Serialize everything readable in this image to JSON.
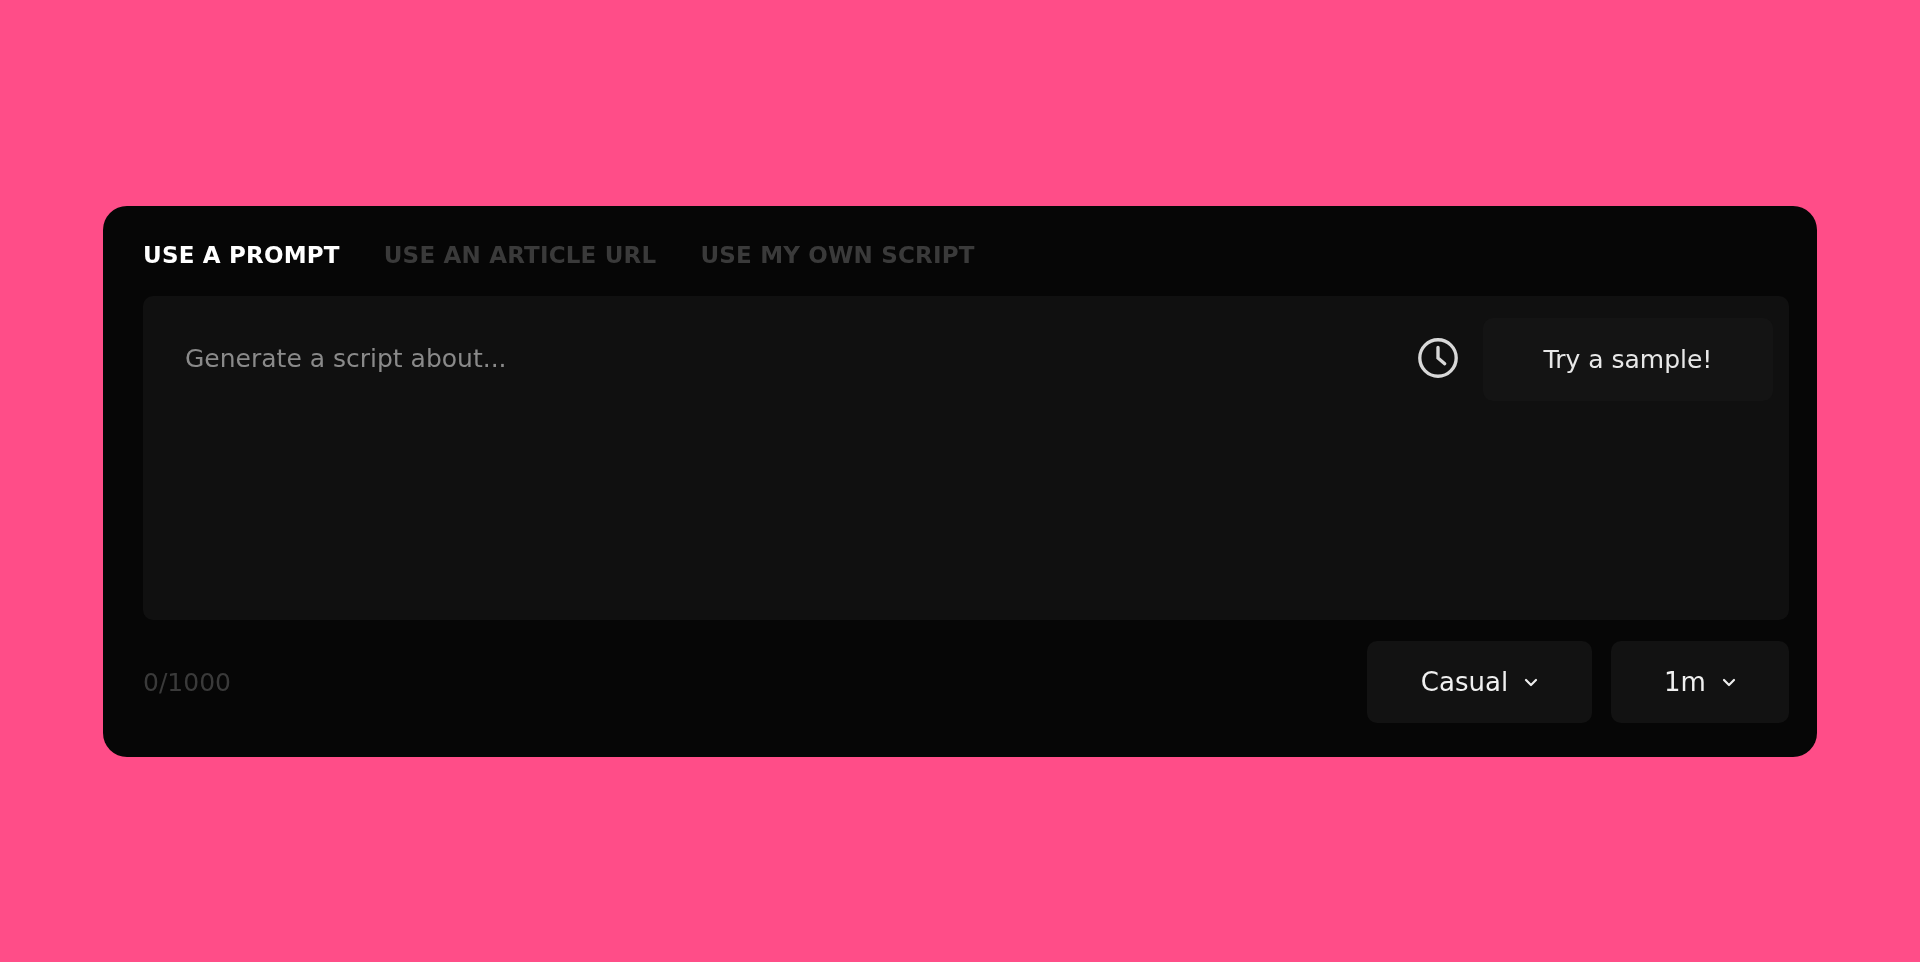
{
  "tabs": [
    {
      "label": "USE A PROMPT",
      "selected": true
    },
    {
      "label": "USE AN ARTICLE URL",
      "selected": false
    },
    {
      "label": "USE MY OWN SCRIPT",
      "selected": false
    }
  ],
  "prompt": {
    "placeholder": "Generate a script about...",
    "sample_button": "Try a sample!"
  },
  "counter": "0/1000",
  "dropdowns": [
    {
      "value": "Casual"
    },
    {
      "value": "1m"
    }
  ]
}
